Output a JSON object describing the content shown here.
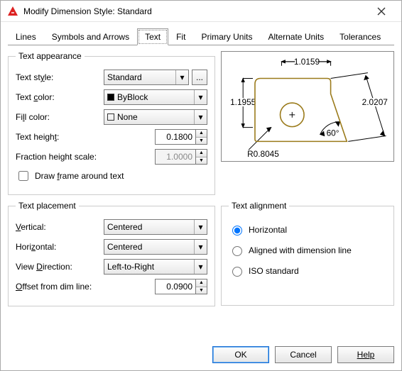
{
  "window": {
    "title": "Modify Dimension Style: Standard"
  },
  "tabs": {
    "lines": "Lines",
    "symbols": "Symbols and Arrows",
    "text": "Text",
    "fit": "Fit",
    "primary": "Primary Units",
    "alternate": "Alternate Units",
    "tolerances": "Tolerances",
    "active": "text"
  },
  "appearance": {
    "legend": "Text appearance",
    "style_label": "Text style:",
    "style_value": "Standard",
    "style_browse": "...",
    "color_label": "Text color:",
    "color_value": "ByBlock",
    "fill_label": "Fill color:",
    "fill_value": "None",
    "height_label": "Text height:",
    "height_value": "0.1800",
    "fraction_label": "Fraction height scale:",
    "fraction_value": "1.0000",
    "drawframe_label": "Draw frame around text",
    "drawframe_checked": false
  },
  "placement": {
    "legend": "Text placement",
    "vertical_label": "Vertical:",
    "vertical_value": "Centered",
    "horizontal_label": "Horizontal:",
    "horizontal_value": "Centered",
    "viewdir_label": "View Direction:",
    "viewdir_value": "Left-to-Right",
    "offset_label": "Offset from dim line:",
    "offset_value": "0.0900"
  },
  "alignment": {
    "legend": "Text alignment",
    "horizontal_label": "Horizontal",
    "aligned_label": "Aligned with dimension line",
    "iso_label": "ISO standard",
    "selected": "horizontal"
  },
  "preview": {
    "dim_top": "1.0159",
    "dim_left": "1.1955",
    "dim_right": "2.0207",
    "dim_angle": "60°",
    "dim_radius": "R0.8045"
  },
  "footer": {
    "ok": "OK",
    "cancel": "Cancel",
    "help": "Help"
  }
}
